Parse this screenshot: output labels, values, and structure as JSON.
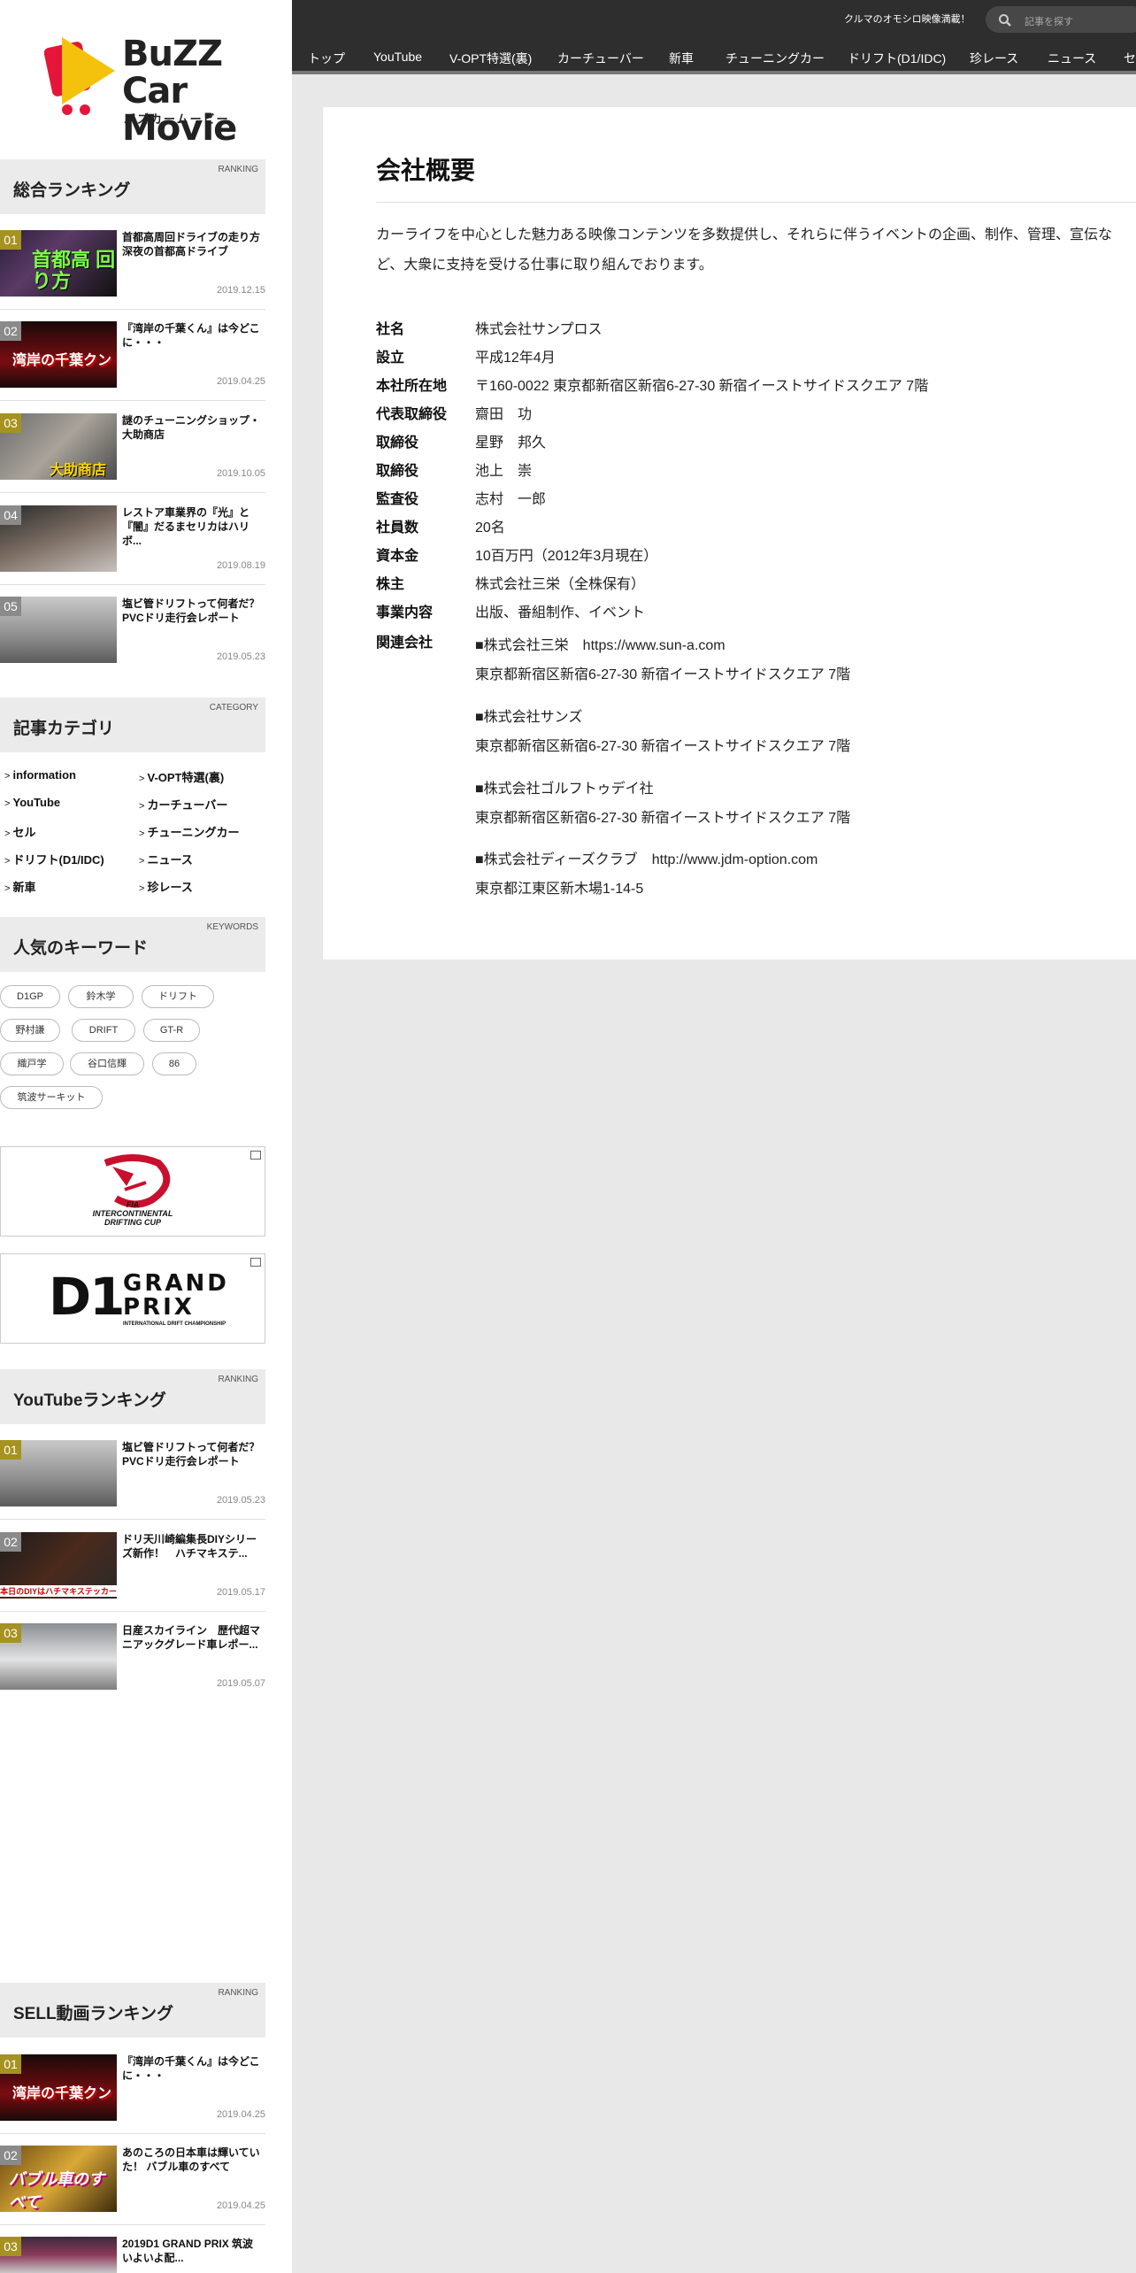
{
  "header": {
    "tagline": "クルマのオモシロ映像満載！",
    "search_placeholder": "記事を探す",
    "nav": [
      "トップ",
      "YouTube",
      "V-OPT特選(裏)",
      "カーチューバー",
      "新車",
      "チューニングカー",
      "ドリフト(D1/IDC)",
      "珍レース",
      "ニュース",
      "セ"
    ]
  },
  "logo": {
    "line1": "BuZZ Car",
    "line2": "Movie",
    "sub": "バズカームービー"
  },
  "sidebar": {
    "ranking": {
      "tag": "RANKING",
      "title": "総合ランキング",
      "items": [
        {
          "num": "01",
          "title": "首都高周回ドライブの走り方 深夜の首都高ドライブ",
          "date": "2019.12.15",
          "thumb_text": "首都高 回り方"
        },
        {
          "num": "02",
          "title": "『湾岸の千葉くん』は今どこに・・・",
          "date": "2019.04.25",
          "thumb_text": "湾岸の千葉クン"
        },
        {
          "num": "03",
          "title": "謎のチューニングショップ・大助商店",
          "date": "2019.10.05",
          "thumb_text": "大助商店"
        },
        {
          "num": "04",
          "title": "レストア車業界の『光』と『闇』だるまセリカはハリボ...",
          "date": "2019.08.19",
          "thumb_text": ""
        },
        {
          "num": "05",
          "title": "塩ビ管ドリフトって何者だ？ PVCドリ走行会レポート",
          "date": "2019.05.23",
          "thumb_text": ""
        }
      ]
    },
    "category": {
      "tag": "CATEGORY",
      "title": "記事カテゴリ",
      "items": [
        "information",
        "V-OPT特選(裏)",
        "YouTube",
        "カーチューバー",
        "セル",
        "チューニングカー",
        "ドリフト(D1/IDC)",
        "ニュース",
        "新車",
        "珍レース"
      ]
    },
    "keywords": {
      "tag": "KEYWORDS",
      "title": "人気のキーワード",
      "items": [
        "D1GP",
        "鈴木学",
        "ドリフト",
        "野村謙",
        "DRIFT",
        "GT-R",
        "織戸学",
        "谷口信輝",
        "86",
        "筑波サーキット"
      ]
    },
    "banners": [
      {
        "name": "FIA INTERCONTINENTAL DRIFTING CUP",
        "line1": "FIA",
        "line2": "INTERCONTINENTAL",
        "line3": "DRIFTING CUP"
      },
      {
        "name": "D1 GRAND PRIX",
        "big": "D1",
        "line1": "GRAND",
        "line2": "PRIX",
        "line3": "INTERNATIONAL DRIFT CHAMPIONSHIP"
      }
    ],
    "youtube_ranking": {
      "tag": "RANKING",
      "title": "YouTubeランキング",
      "items": [
        {
          "num": "01",
          "title": "塩ビ管ドリフトって何者だ？ PVCドリ走行会レポート",
          "date": "2019.05.23"
        },
        {
          "num": "02",
          "title": "ドリ天川崎編集長DIYシリーズ新作！　ハチマキステ...",
          "date": "2019.05.17",
          "caption": "本日のDIYはハチマキステッカー"
        },
        {
          "num": "03",
          "title": "日産スカイライン　歴代超マニアックグレード車レポー...",
          "date": "2019.05.07"
        }
      ]
    },
    "sell_ranking": {
      "tag": "RANKING",
      "title": "SELL動画ランキング",
      "items": [
        {
          "num": "01",
          "title": "『湾岸の千葉くん』は今どこに・・・",
          "date": "2019.04.25",
          "thumb_text": "湾岸の千葉クン"
        },
        {
          "num": "02",
          "title": "あのころの日本車は輝いていた！ バブル車のすべて",
          "date": "2019.04.25",
          "thumb_text": "バブル車のすべて"
        },
        {
          "num": "03",
          "title": "2019D1 GRAND PRIX 筑波いよいよ配...",
          "date": ""
        }
      ]
    }
  },
  "main": {
    "title": "会社概要",
    "intro": "カーライフを中心とした魅力ある映像コンテンツを多数提供し、それらに伴うイベントの企画、制作、管理、宣伝など、大衆に支持を受ける仕事に取り組んでおります。",
    "rows": [
      {
        "label": "社名",
        "value": "株式会社サンプロス"
      },
      {
        "label": "設立",
        "value": "平成12年4月"
      },
      {
        "label": "本社所在地",
        "value": "〒160-0022 東京都新宿区新宿6-27-30 新宿イーストサイドスクエア 7階"
      },
      {
        "label": "代表取締役",
        "value": "齋田　功"
      },
      {
        "label": "取締役",
        "value": "星野　邦久"
      },
      {
        "label": "取締役",
        "value": "池上　崇"
      },
      {
        "label": "監査役",
        "value": "志村　一郎"
      },
      {
        "label": "社員数",
        "value": "20名"
      },
      {
        "label": "資本金",
        "value": "10百万円（2012年3月現在）"
      },
      {
        "label": "株主",
        "value": "株式会社三栄（全株保有）"
      },
      {
        "label": "事業内容",
        "value": "出版、番組制作、イベント"
      }
    ],
    "related_label": "関連会社",
    "related": [
      {
        "name": "■株式会社三栄　https://www.sun-a.com",
        "address": "東京都新宿区新宿6-27-30 新宿イーストサイドスクエア 7階"
      },
      {
        "name": "■株式会社サンズ",
        "address": "東京都新宿区新宿6-27-30 新宿イーストサイドスクエア 7階"
      },
      {
        "name": "■株式会社ゴルフトゥデイ社",
        "address": "東京都新宿区新宿6-27-30 新宿イーストサイドスクエア 7階"
      },
      {
        "name": "■株式会社ディーズクラブ　http://www.jdm-option.com",
        "address": "東京都江東区新木場1-14-5"
      }
    ]
  },
  "colors": {
    "accent_yellow": "#f4c20d",
    "accent_red": "#e5163a",
    "gold_badge": "#a59220",
    "topbar": "#2e2e2e"
  }
}
